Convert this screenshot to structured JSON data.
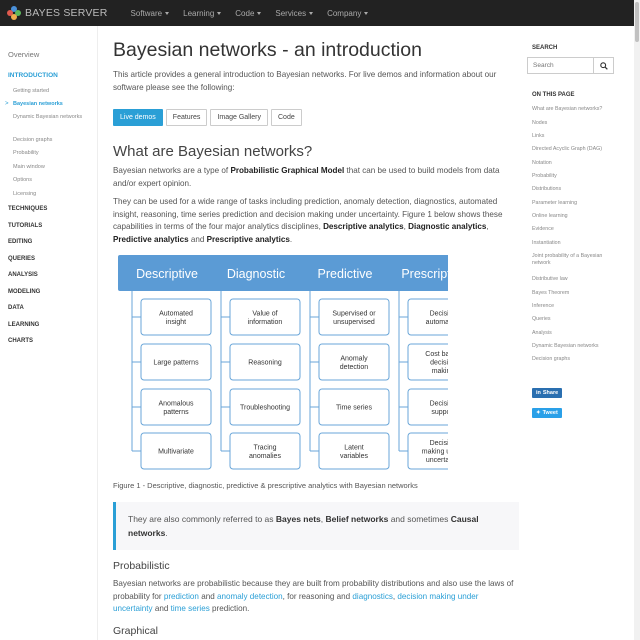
{
  "navbar": {
    "brand": "BAYES SERVER",
    "items": [
      "Software",
      "Learning",
      "Code",
      "Services",
      "Company"
    ]
  },
  "leftbar": {
    "overview": "Overview",
    "introduction": "INTRODUCTION",
    "sub_items": [
      "Getting started",
      "Bayesian networks",
      "Dynamic Bayesian networks",
      "Decision graphs",
      "Probability",
      "Main window",
      "Options",
      "Licensing"
    ],
    "active_sub_index": 1,
    "sections": [
      "TECHNIQUES",
      "TUTORIALS",
      "EDITING",
      "QUERIES",
      "ANALYSIS",
      "MODELING",
      "DATA",
      "LEARNING",
      "CHARTS"
    ]
  },
  "main": {
    "title": "Bayesian networks - an introduction",
    "intro": "This article provides a general introduction to Bayesian networks. For live demos and information about our software please see the following:",
    "buttons": [
      "Live demos",
      "Features",
      "Image Gallery",
      "Code"
    ],
    "h2": "What are Bayesian networks?",
    "p1_pre": "Bayesian networks are a type of ",
    "p1_bold": "Probabilistic Graphical Model",
    "p1_post": " that can be used to build models from data and/or expert opinion.",
    "p2_pre": "They can be used for a wide range of tasks including prediction, anomaly detection, diagnostics, automated insight, reasoning, time series prediction and decision making under uncertainty. Figure 1 below shows these capabilities in terms of the four major analytics disciplines, ",
    "p2_b1": "Descriptive analytics",
    "p2_sep1": ", ",
    "p2_b2": "Diagnostic analytics",
    "p2_sep2": ", ",
    "p2_b3": "Predictive analytics",
    "p2_sep3": " and ",
    "p2_b4": "Prescriptive analytics",
    "p2_end": ".",
    "figure": {
      "columns": [
        {
          "header": "Descriptive",
          "items": [
            "Automated insight",
            "Large patterns",
            "Anomalous patterns",
            "Multivariate"
          ]
        },
        {
          "header": "Diagnostic",
          "items": [
            "Value of information",
            "Reasoning",
            "Troubleshooting",
            "Tracing anomalies"
          ]
        },
        {
          "header": "Predictive",
          "items": [
            "Supervised or unsupervised",
            "Anomaly detection",
            "Time series",
            "Latent variables"
          ]
        },
        {
          "header": "Prescriptive",
          "items": [
            "Decision automation",
            "Cost based decision making",
            "Decision support",
            "Decision making under uncertainty"
          ]
        }
      ],
      "header_color": "#5b9bd5",
      "item_border_color": "#6aa6d8"
    },
    "caption": "Figure 1 - Descriptive, diagnostic, predictive & prescriptive analytics with Bayesian networks",
    "quote_pre": "They are also commonly referred to as ",
    "quote_b1": "Bayes nets",
    "quote_sep1": ", ",
    "quote_b2": "Belief networks",
    "quote_sep2": " and sometimes ",
    "quote_b3": "Causal networks",
    "quote_end": ".",
    "h3_probabilistic": "Probabilistic",
    "prob_pre": "Bayesian networks are probabilistic because they are built from probability distributions and also use the laws of probability for ",
    "prob_l1": "prediction",
    "prob_sep1": " and ",
    "prob_l2": "anomaly detection",
    "prob_sep2": ", for reasoning and ",
    "prob_l3": "diagnostics",
    "prob_sep3": ", ",
    "prob_l4": "decision making under uncertainty",
    "prob_sep4": " and ",
    "prob_l5": "time series",
    "prob_end": " prediction.",
    "h3_graphical": "Graphical"
  },
  "rightbar": {
    "search_label": "SEARCH",
    "search_placeholder": "Search",
    "on_this_page": "ON THIS PAGE",
    "links": [
      "What are Bayesian networks?",
      "Nodes",
      "Links",
      "Directed Acyclic Graph (DAG)",
      "Notation",
      "Probability",
      "Distributions",
      "Parameter learning",
      "Online learning",
      "Evidence",
      "Instantiation",
      "Joint probability of a Bayesian network",
      "Distributive law",
      "Bayes Theorem",
      "Inference",
      "Queries",
      "Analysis",
      "Dynamic Bayesian networks",
      "Decision graphs"
    ],
    "share": "Share",
    "tweet": "Tweet"
  },
  "colors": {
    "accent": "#2a9fd6",
    "navbar": "#222222",
    "logo": [
      "#4a90d9",
      "#e05a4e",
      "#5cb85c",
      "#f0ad4e"
    ]
  }
}
